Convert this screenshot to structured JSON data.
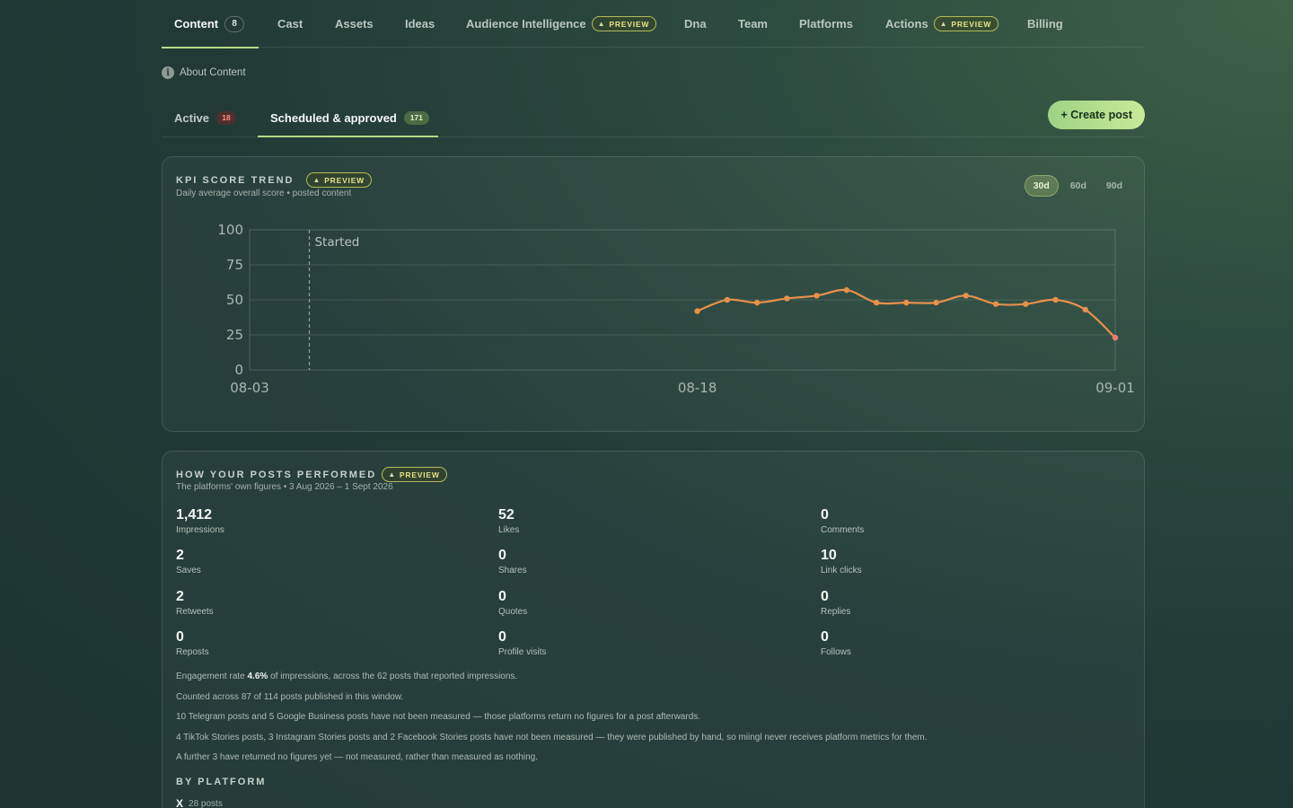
{
  "nav": {
    "tabs": [
      {
        "label": "Content",
        "count": "8",
        "active": true
      },
      {
        "label": "Cast"
      },
      {
        "label": "Assets"
      },
      {
        "label": "Ideas"
      },
      {
        "label": "Audience Intelligence",
        "badge": "PREVIEW"
      },
      {
        "label": "Dna"
      },
      {
        "label": "Team"
      },
      {
        "label": "Platforms"
      },
      {
        "label": "Actions",
        "badge": "PREVIEW"
      },
      {
        "label": "Billing"
      }
    ]
  },
  "about": {
    "icon": "info-icon",
    "label": "About Content"
  },
  "subtabs": [
    {
      "label": "Active",
      "count": "18"
    },
    {
      "label": "Scheduled & approved",
      "count": "171",
      "active": true
    }
  ],
  "create_button": "+ Create post",
  "kpi": {
    "title": "KPI SCORE TREND",
    "badge": "PREVIEW",
    "subtitle": "Daily average overall score • posted content",
    "ranges": [
      {
        "label": "30d",
        "active": true
      },
      {
        "label": "60d"
      },
      {
        "label": "90d"
      }
    ]
  },
  "chart_data": {
    "type": "line",
    "ylim": [
      0,
      100
    ],
    "yticks": [
      "0",
      "25",
      "50",
      "75",
      "100"
    ],
    "xticks": [
      "08-03",
      "08-18",
      "09-01"
    ],
    "x_start_day": "08-03",
    "x_end_day": "09-01",
    "annotation": {
      "label": "Started",
      "x": "08-05"
    },
    "series": [
      {
        "color": "#e8904a",
        "points": [
          {
            "x": "08-18",
            "y": 42
          },
          {
            "x": "08-19",
            "y": 50
          },
          {
            "x": "08-20",
            "y": 48
          },
          {
            "x": "08-21",
            "y": 51
          },
          {
            "x": "08-22",
            "y": 53
          },
          {
            "x": "08-23",
            "y": 57
          },
          {
            "x": "08-24",
            "y": 48
          },
          {
            "x": "08-25",
            "y": 48
          },
          {
            "x": "08-26",
            "y": 48
          },
          {
            "x": "08-27",
            "y": 53
          },
          {
            "x": "08-28",
            "y": 47
          },
          {
            "x": "08-29",
            "y": 47
          },
          {
            "x": "08-30",
            "y": 50
          },
          {
            "x": "08-31",
            "y": 43
          },
          {
            "x": "09-01",
            "y": 23
          }
        ]
      }
    ]
  },
  "performance": {
    "title": "HOW YOUR POSTS PERFORMED",
    "badge": "PREVIEW",
    "subtitle": "The platforms' own figures • 3 Aug 2026 – 1 Sept 2026",
    "stats": [
      {
        "value": "1,412",
        "label": "Impressions"
      },
      {
        "value": "52",
        "label": "Likes"
      },
      {
        "value": "0",
        "label": "Comments"
      },
      {
        "value": "2",
        "label": "Saves"
      },
      {
        "value": "0",
        "label": "Shares"
      },
      {
        "value": "10",
        "label": "Link clicks"
      },
      {
        "value": "2",
        "label": "Retweets"
      },
      {
        "value": "0",
        "label": "Quotes"
      },
      {
        "value": "0",
        "label": "Replies"
      },
      {
        "value": "0",
        "label": "Reposts"
      },
      {
        "value": "0",
        "label": "Profile visits"
      },
      {
        "value": "0",
        "label": "Follows"
      }
    ],
    "engagement_prefix": "Engagement rate ",
    "engagement_rate": "4.6%",
    "engagement_suffix": " of impressions, across the 62 posts that reported impressions.",
    "notes": [
      "Counted across 87 of 114 posts published in this window.",
      "10 Telegram posts and 5 Google Business posts have not been measured — those platforms return no figures for a post afterwards.",
      "4 TikTok Stories posts, 3 Instagram Stories posts and 2 Facebook Stories posts have not been measured — they were published by hand, so miingl never receives platform metrics for them.",
      "A further 3 have returned no figures yet — not measured, rather than measured as nothing."
    ],
    "by_platform_title": "BY PLATFORM",
    "platforms": [
      {
        "icon": "x-icon",
        "glyph": "X",
        "posts": "28 posts"
      }
    ]
  }
}
